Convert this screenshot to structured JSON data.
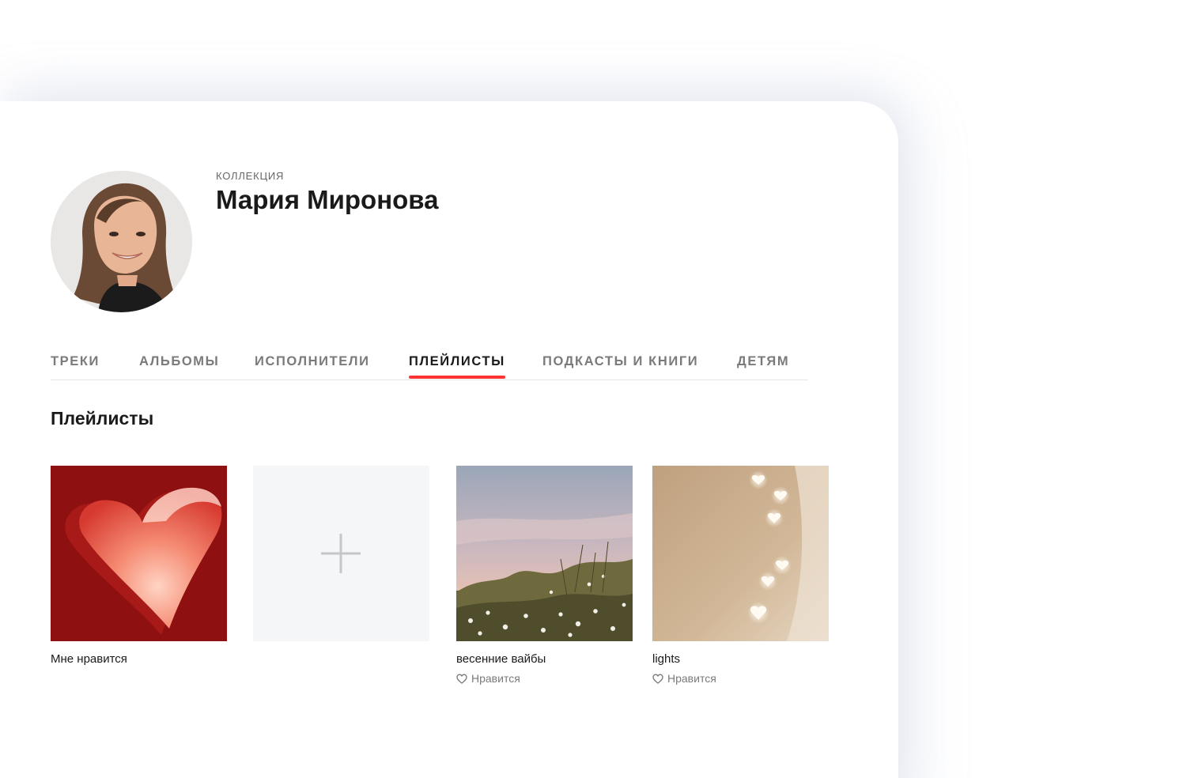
{
  "header": {
    "eyebrow": "КОЛЛЕКЦИЯ",
    "title": "Мария Миронова"
  },
  "tabs": [
    {
      "label": "ТРЕКИ"
    },
    {
      "label": "АЛЬБОМЫ"
    },
    {
      "label": "ИСПОЛНИТЕЛИ"
    },
    {
      "label": "ПЛЕЙЛИСТЫ",
      "active": true
    },
    {
      "label": "ПОДКАСТЫ И КНИГИ"
    },
    {
      "label": "ДЕТЯМ"
    }
  ],
  "section": {
    "title": "Плейлисты"
  },
  "playlists": [
    {
      "name": "Мне нравится",
      "cover_icon": "heart-cover"
    },
    {
      "name": "",
      "cover_icon": "plus-icon"
    },
    {
      "name": "весенние вайбы",
      "subtitle": "Нравится",
      "cover_icon": "meadow-cover"
    },
    {
      "name": "lights",
      "subtitle": "Нравится",
      "cover_icon": "lights-cover"
    }
  ],
  "colors": {
    "accent": "#ff3333",
    "muted_text": "#7a7a7a",
    "add_tile_bg": "#f5f6f8"
  }
}
